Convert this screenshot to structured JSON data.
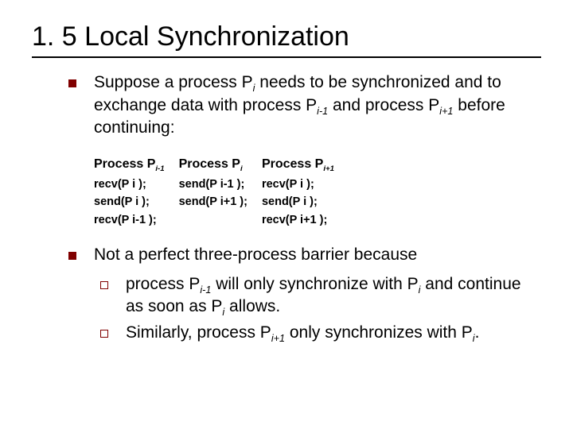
{
  "title": "1. 5 Local Synchronization",
  "bullets": [
    {
      "text_html": "Suppose a process P<sub>i</sub> needs to be synchronized and to exchange data with process P<sub>i-1</sub> and process P<sub>i+1</sub> before continuing:"
    },
    {
      "text_html": "Not a perfect three-process barrier because"
    }
  ],
  "sub_bullets": [
    {
      "text_html": "process P<sub>i-1</sub> will only synchronize with P<sub>i</sub> and continue as soon as P<sub>i</sub> allows."
    },
    {
      "text_html": "Similarly, process P<sub>i+1</sub> only synchronizes with P<sub>i</sub>."
    }
  ],
  "code": {
    "headers": [
      "Process P<sub>i-1</sub>",
      "Process P<sub>i</sub>",
      "Process P<sub>i+1</sub>"
    ],
    "cols": [
      [
        "recv(P i );",
        "send(P i );",
        "recv(P i-1 );"
      ],
      [
        "send(P i-1 );",
        "send(P i+1 );"
      ],
      [
        "recv(P i );",
        "send(P i );",
        "recv(P i+1 );"
      ]
    ]
  },
  "chart_data": {
    "type": "table",
    "title": "Local synchronization pseudocode for three neighboring processes",
    "columns": [
      "Process P_{i-1}",
      "Process P_i",
      "Process P_{i+1}"
    ],
    "rows": [
      [
        "recv(P_i);",
        "send(P_{i-1});",
        "recv(P_i);"
      ],
      [
        "send(P_i);",
        "send(P_{i+1});",
        "send(P_i);"
      ],
      [
        "recv(P_{i-1});",
        "",
        "recv(P_{i+1});"
      ]
    ]
  }
}
